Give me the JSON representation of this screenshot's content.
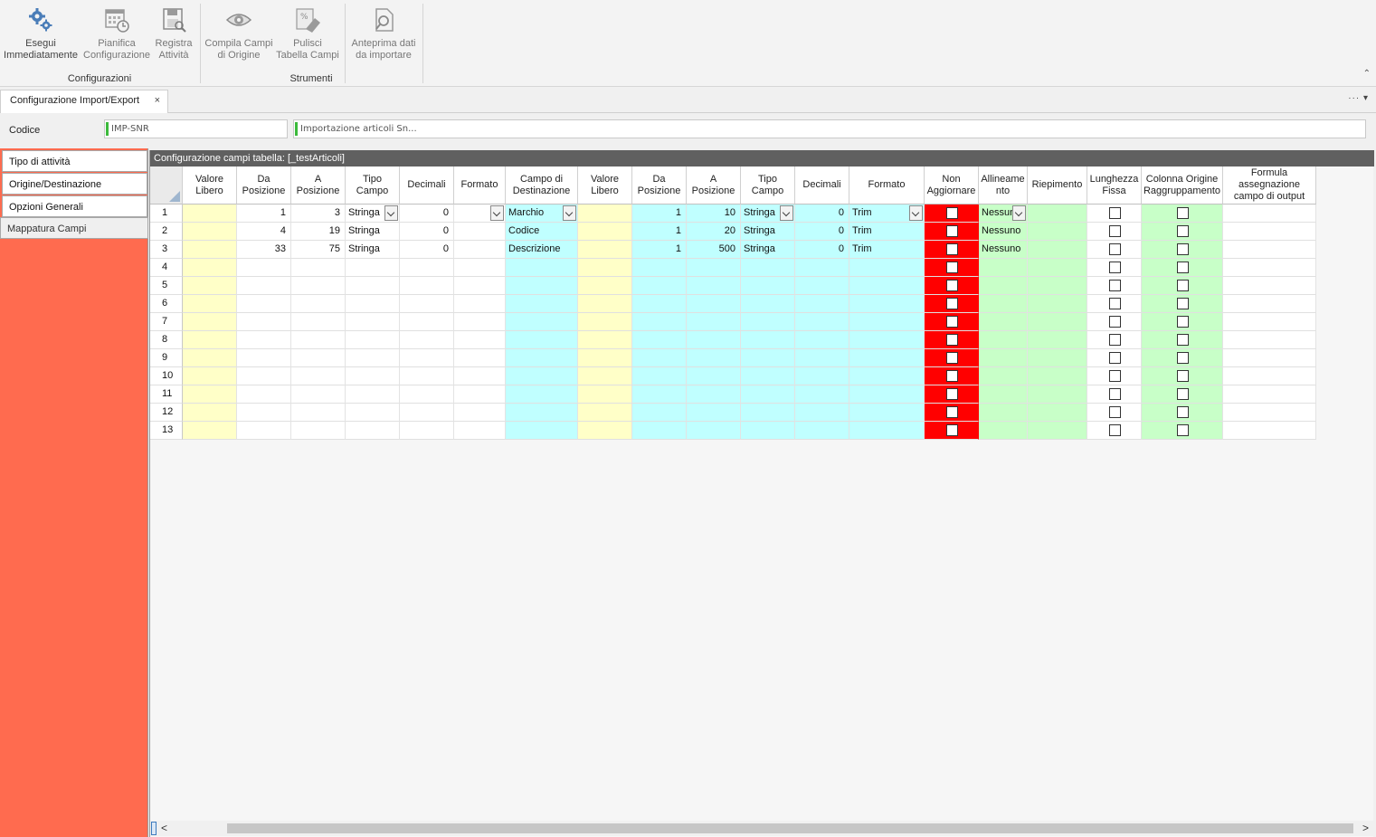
{
  "ribbon": {
    "buttons": [
      {
        "label1": "Esegui",
        "label2": "Immediatamente",
        "icon": "gears-icon"
      },
      {
        "label1": "Pianifica",
        "label2": "Configurazione",
        "icon": "calendar-clock-icon"
      },
      {
        "label1": "Registra",
        "label2": "Attività",
        "icon": "save-log-icon"
      },
      {
        "label1": "Compila Campi",
        "label2": "di Origine",
        "icon": "eye-icon"
      },
      {
        "label1": "Pulisci",
        "label2": "Tabella Campi",
        "icon": "eraser-icon"
      },
      {
        "label1": "Anteprima dati",
        "label2": "da importare",
        "icon": "preview-document-icon"
      }
    ],
    "groups": [
      "Configurazioni",
      "Strumenti"
    ],
    "collapse_glyph": "⌃"
  },
  "doc_tab": {
    "label": "Configurazione Import/Export",
    "close": "×",
    "menu": "···  ▾"
  },
  "header": {
    "codice_label": "Codice",
    "codice_value": "IMP-SNR",
    "description_value": "Importazione articoli Sn..."
  },
  "nav": {
    "items": [
      "Tipo di attività",
      "Origine/Destinazione",
      "Opzioni Generali",
      "Mappatura Campi"
    ],
    "active": "Mappatura Campi"
  },
  "grid": {
    "caption": "Configurazione campi tabella: [_testArticoli]",
    "columns": [
      "",
      "Valore Libero",
      "Da Posizione",
      "A Posizione",
      "Tipo Campo",
      "Decimali",
      "Formato",
      "Campo di Destinazione",
      "Valore Libero",
      "Da Posizione",
      "A Posizione",
      "Tipo Campo",
      "Decimali",
      "Formato",
      "Non Aggiornare",
      "Allineame nto",
      "Riepimento",
      "Lunghezza Fissa",
      "Colonna Origine Raggruppamento",
      "Formula assegnazione campo di output"
    ],
    "rows": [
      {
        "n": "1",
        "valore": "",
        "da": "1",
        "a": "3",
        "tipo": "Stringa",
        "dec": "0",
        "formato": "",
        "campo": "Marchio",
        "valore2": "",
        "da2": "1",
        "a2": "10",
        "tipo2": "Stringa",
        "dec2": "0",
        "formato2": "Trim",
        "allin": "Nessun"
      },
      {
        "n": "2",
        "valore": "",
        "da": "4",
        "a": "19",
        "tipo": "Stringa",
        "dec": "0",
        "formato": "",
        "campo": "Codice",
        "valore2": "",
        "da2": "1",
        "a2": "20",
        "tipo2": "Stringa",
        "dec2": "0",
        "formato2": "Trim",
        "allin": "Nessuno"
      },
      {
        "n": "3",
        "valore": "",
        "da": "33",
        "a": "75",
        "tipo": "Stringa",
        "dec": "0",
        "formato": "",
        "campo": "Descrizione",
        "valore2": "",
        "da2": "1",
        "a2": "500",
        "tipo2": "Stringa",
        "dec2": "0",
        "formato2": "Trim",
        "allin": "Nessuno"
      },
      {
        "n": "4"
      },
      {
        "n": "5"
      },
      {
        "n": "6"
      },
      {
        "n": "7"
      },
      {
        "n": "8"
      },
      {
        "n": "9"
      },
      {
        "n": "10"
      },
      {
        "n": "11"
      },
      {
        "n": "12"
      },
      {
        "n": "13"
      }
    ]
  },
  "scrollbar": {
    "left": "<",
    "right": ">"
  },
  "colors": {
    "nav_bg": "#ff6b4f",
    "source_free_value": "#ffffc8",
    "destination": "#c0ffff",
    "non_aggiornare": "#ff0000",
    "output_options": "#c8ffc8",
    "caption_bg": "#606060"
  }
}
